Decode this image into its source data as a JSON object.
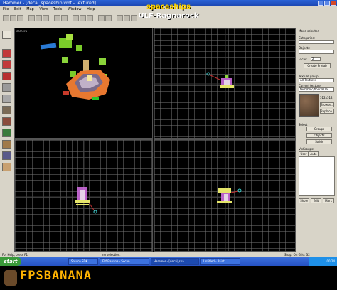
{
  "window": {
    "title": "Hammer - [decal_spaceship.vmf - Textured]"
  },
  "overlay": {
    "line1": "spaceships",
    "line2": "ULF-Ragnarock"
  },
  "menu": [
    "File",
    "Edit",
    "Map",
    "View",
    "Tools",
    "Window",
    "Help"
  ],
  "viewports": {
    "camera_label": "camera"
  },
  "right_panel": {
    "move_selected": "Move selected",
    "categories_label": "Categories:",
    "objects_label": "Objects:",
    "faces_label": "Faces:",
    "faces_value": "2",
    "create_prefab": "Create Prefab",
    "texture_group_label": "Texture group:",
    "texture_group_value": "All Textures",
    "current_texture_label": "Current texture:",
    "current_texture_value": "tech/bloc/floor001a",
    "texture_size": "512x512",
    "browse": "Browse...",
    "replace": "Replace...",
    "select_label": "Select",
    "groups": "Groups",
    "objects_btn": "Objects",
    "solids": "Solids",
    "visgroups_label": "VisGroups:",
    "tab_user": "User",
    "tab_auto": "Auto",
    "show": "Show",
    "edit": "Edit",
    "mark": "Mark"
  },
  "status": {
    "help": "For Help, press F1",
    "selection": "no selection.",
    "snap": "Snap: On Grid: 32"
  },
  "taskbar": {
    "start": "start",
    "tasks": [
      "Source SDK",
      "FPSBanana - Secon...",
      "Hammer - [decal_spa...",
      "Untitled - Paint"
    ],
    "clock": "00:24"
  },
  "banner": {
    "logo_text": "FPSBANANA"
  },
  "colors": {
    "accent": "#ffd400",
    "logo": "#ffb300",
    "taskbar": "#2552c4"
  }
}
